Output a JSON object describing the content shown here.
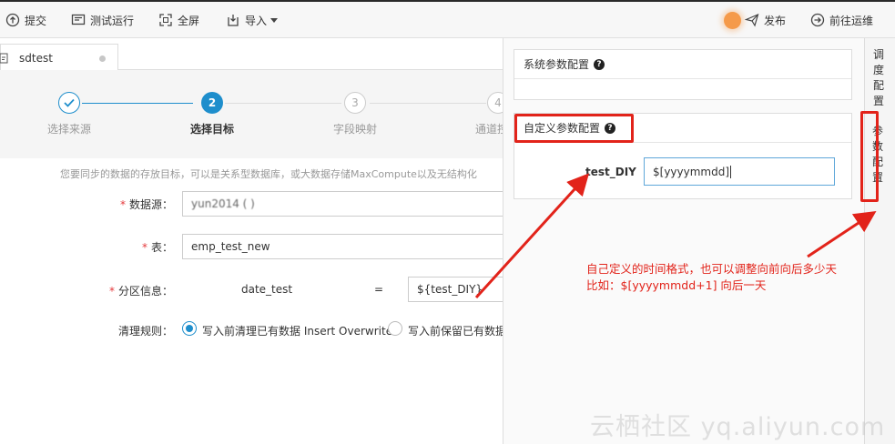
{
  "toolbar": {
    "submit": "提交",
    "test_run": "测试运行",
    "fullscreen": "全屏",
    "import": "导入",
    "publish": "发布",
    "goto_ops": "前往运维"
  },
  "tab": {
    "title": "sdtest"
  },
  "steps": [
    {
      "index": "",
      "label": "选择来源",
      "state": "done"
    },
    {
      "index": "2",
      "label": "选择目标",
      "state": "active"
    },
    {
      "index": "3",
      "label": "字段映射",
      "state": "todo"
    },
    {
      "index": "4",
      "label": "通道控",
      "state": "todo"
    }
  ],
  "form": {
    "description": "您要同步的数据的存放目标，可以是关系型数据库，或大数据存储MaxCompute以及无结构化",
    "datasource_label": "数据源：",
    "datasource_value": "yun2014 ( )",
    "table_label": "表：",
    "table_value": "emp_test_new",
    "partition_label": "分区信息：",
    "partition_key": "date_test",
    "partition_eq": "=",
    "partition_value": "${test_DIY}",
    "cleanup_label": "清理规则：",
    "cleanup_opt1": "写入前清理已有数据 Insert Overwrite",
    "cleanup_opt2": "写入前保留已有数据"
  },
  "right_panel": {
    "system_params": "系统参数配置",
    "custom_params": "自定义参数配置",
    "param_name": "test_DIY",
    "param_value": "$[yyyymmdd]"
  },
  "right_sidebar": {
    "schedule_config": [
      "调",
      "度",
      "配",
      "置"
    ],
    "param_config": [
      "参",
      "数",
      "配",
      "置"
    ]
  },
  "annotation": {
    "line1": "自己定义的时间格式，也可以调整向前向后多少天",
    "line2": "比如：$[yyyymmdd+1] 向后一天"
  },
  "watermark": "云栖社区 yq.aliyun.com",
  "colors": {
    "accent": "#1e8ecc",
    "annotation": "#e2231a",
    "publish_dot": "#f59a4a"
  }
}
